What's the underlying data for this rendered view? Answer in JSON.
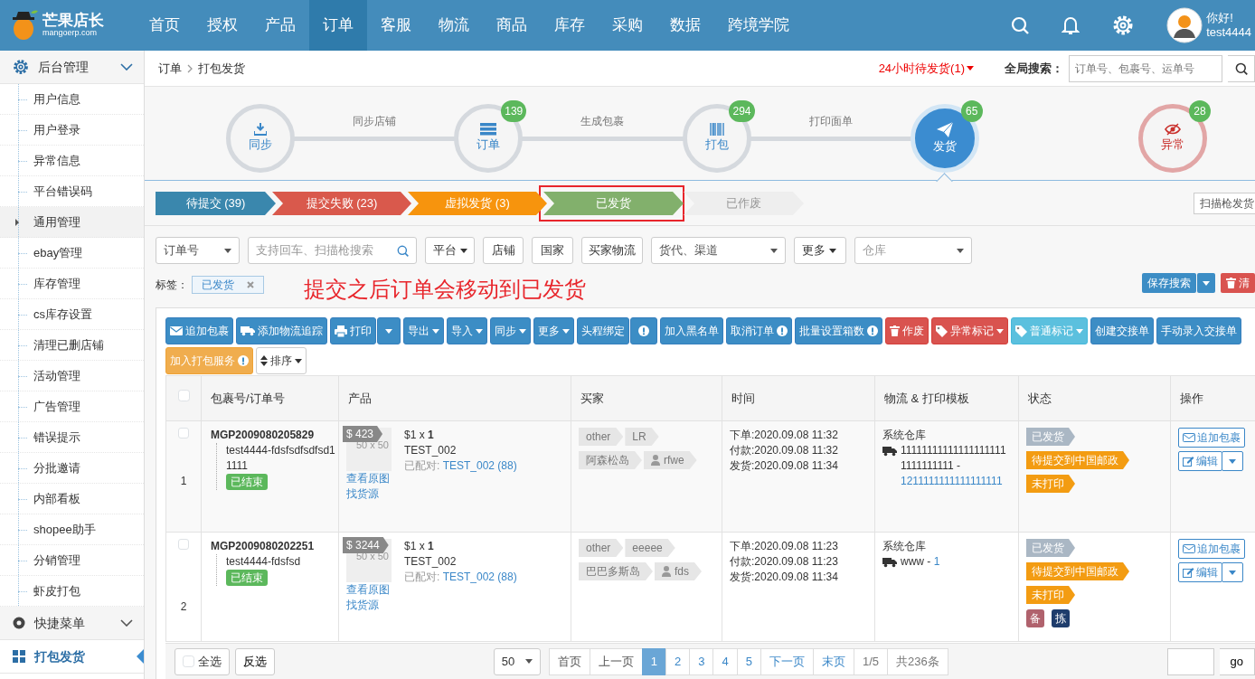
{
  "header": {
    "logo": {
      "name": "芒果店长",
      "domain": "mangoerp.com"
    },
    "nav": [
      {
        "label": "首页",
        "selected": false
      },
      {
        "label": "授权",
        "selected": false
      },
      {
        "label": "产品",
        "selected": false
      },
      {
        "label": "订单",
        "selected": true
      },
      {
        "label": "客服",
        "selected": false
      },
      {
        "label": "物流",
        "selected": false
      },
      {
        "label": "商品",
        "selected": false
      },
      {
        "label": "库存",
        "selected": false
      },
      {
        "label": "采购",
        "selected": false
      },
      {
        "label": "数据",
        "selected": false
      },
      {
        "label": "跨境学院",
        "selected": false
      }
    ],
    "user": {
      "greeting": "你好!",
      "name": "test4444"
    }
  },
  "sidebar": {
    "groups": [
      {
        "label": "后台管理",
        "selected": false,
        "items": [
          {
            "label": "用户信息",
            "selected": false
          },
          {
            "label": "用户登录",
            "selected": false
          },
          {
            "label": "异常信息",
            "selected": false
          },
          {
            "label": "平台错误码",
            "selected": false
          },
          {
            "label": "通用管理",
            "selected": true
          },
          {
            "label": "ebay管理",
            "selected": false
          },
          {
            "label": "库存管理",
            "selected": false
          },
          {
            "label": "cs库存设置",
            "selected": false
          },
          {
            "label": "清理已删店铺",
            "selected": false
          },
          {
            "label": "活动管理",
            "selected": false
          },
          {
            "label": "广告管理",
            "selected": false
          },
          {
            "label": "错误提示",
            "selected": false
          },
          {
            "label": "分批邀请",
            "selected": false
          },
          {
            "label": "内部看板",
            "selected": false
          },
          {
            "label": "shopee助手",
            "selected": false
          },
          {
            "label": "分销管理",
            "selected": false
          },
          {
            "label": "虾皮打包",
            "selected": false
          }
        ]
      },
      {
        "label": "快捷菜单",
        "selected": false
      },
      {
        "label": "打包发货",
        "selected": true
      }
    ]
  },
  "breadcrumb": {
    "items": [
      "订单",
      "打包发货"
    ],
    "alert": "24小时待发货(1)",
    "search_label": "全局搜索：",
    "search_placeholder": "订单号、包裹号、运单号"
  },
  "workflow": [
    {
      "kind": "step",
      "label": "同步",
      "selected": false,
      "alert": false
    },
    {
      "kind": "link",
      "label": "同步店铺"
    },
    {
      "kind": "step",
      "label": "订单",
      "count": "139",
      "selected": false,
      "alert": false
    },
    {
      "kind": "link",
      "label": "生成包裹"
    },
    {
      "kind": "step",
      "label": "打包",
      "count": "294",
      "selected": false,
      "alert": false
    },
    {
      "kind": "link",
      "label": "打印面单"
    },
    {
      "kind": "step",
      "label": "发货",
      "count": "65",
      "selected": true,
      "alert": false
    },
    {
      "kind": "step",
      "label": "异常",
      "count": "28",
      "selected": false,
      "alert": true
    }
  ],
  "status_tabs": [
    {
      "label": "待提交 (39)",
      "color": "#3a87ad",
      "selected": false
    },
    {
      "label": "提交失败 (23)",
      "color": "#d9594c",
      "selected": false
    },
    {
      "label": "虚拟发货 (3)",
      "color": "#f7940d",
      "selected": false
    },
    {
      "label": "已发货",
      "color": "#82b06c",
      "selected": true
    },
    {
      "label": "已作废",
      "color": "#eeeeee",
      "selected": false
    }
  ],
  "scan_button": "扫描枪发货",
  "filters": [
    {
      "kind": "select",
      "label": "订单号"
    },
    {
      "kind": "search",
      "placeholder": "支持回车、扫描枪搜索"
    },
    {
      "kind": "dropdown",
      "label": "平台"
    },
    {
      "kind": "button",
      "label": "店铺"
    },
    {
      "kind": "button",
      "label": "国家"
    },
    {
      "kind": "button",
      "label": "买家物流"
    },
    {
      "kind": "select",
      "label": "货代、渠道"
    },
    {
      "kind": "dropdown",
      "label": "更多"
    },
    {
      "kind": "select",
      "placeholder": "仓库"
    }
  ],
  "tags": {
    "label": "标签：",
    "items": [
      "已发货"
    ]
  },
  "annotation": "提交之后订单会移动到已发货",
  "search_actions": [
    {
      "kind": "split",
      "label": "保存搜索"
    },
    {
      "kind": "danger",
      "label": "清"
    }
  ],
  "toolbar": [
    {
      "label": "追加包裹",
      "kind": "plain"
    },
    {
      "label": "添加物流追踪",
      "kind": "plain"
    },
    {
      "label": "打印",
      "kind": "split"
    },
    {
      "label": "导出",
      "kind": "menu"
    },
    {
      "label": "导入",
      "kind": "menu"
    },
    {
      "label": "同步",
      "kind": "menu"
    },
    {
      "label": "更多",
      "kind": "menu"
    },
    {
      "label": "头程绑定",
      "kind": "info-split"
    },
    {
      "label": "加入黑名单",
      "kind": "plain"
    },
    {
      "label": "取消订单",
      "kind": "info"
    },
    {
      "label": "批量设置箱数",
      "kind": "info"
    },
    {
      "label": "作废",
      "kind": "plain"
    },
    {
      "label": "异常标记",
      "kind": "menu"
    },
    {
      "label": "普通标记",
      "kind": "menu"
    },
    {
      "label": "创建交接单",
      "kind": "plain"
    },
    {
      "label": "手动录入交接单",
      "kind": "plain"
    },
    {
      "label": "加入打包服务",
      "kind": "info"
    },
    {
      "label": "排序",
      "kind": "menu"
    }
  ],
  "table": {
    "select_all": {
      "checked": false
    },
    "columns": [
      "包裹号/订单号",
      "产品",
      "买家",
      "时间",
      "物流 & 打印模板",
      "状态",
      "操作"
    ],
    "rows": [
      {
        "checked": false,
        "index": "1",
        "package_no": "MGP2009080205829",
        "order_no": "test4444-fdsfsdfsdfsd11111",
        "order_status": "已结束",
        "price": "$ 423",
        "thumb": "50 x 50",
        "links": [
          "查看原图",
          "找货源"
        ],
        "quantity": "$1 x **1**",
        "sku": "TEST_002",
        "matched_label": "已配对:",
        "matched": "TEST_002 (88)",
        "buyer_tags": [
          "other",
          "LR"
        ],
        "buyer_region": "阿森松岛",
        "buyer_name": "rfwe",
        "times": [
          "下单:2020.09.08 11:32",
          "付款:2020.09.08 11:32",
          "发货:2020.09.08 11:34"
        ],
        "warehouse": "系统仓库",
        "tracking": "111111111111111111111111111111 -",
        "tracking_link": "1211111111111111111",
        "statuses": [
          {
            "label": "已发货",
            "color": "#aab7c4"
          },
          {
            "label": "待提交到中国邮政",
            "color": "#f39c12"
          },
          {
            "label": "未打印",
            "color": "#f39c12"
          }
        ],
        "actions": [
          "追加包裹",
          "编辑"
        ]
      },
      {
        "checked": false,
        "index": "2",
        "package_no": "MGP2009080202251",
        "order_no": "test4444-fdsfsd",
        "order_status": "已结束",
        "price": "$ 3244",
        "thumb": "50 x 50",
        "links": [
          "查看原图",
          "找货源"
        ],
        "quantity": "$1 x **1**",
        "sku": "TEST_002",
        "matched_label": "已配对:",
        "matched": "TEST_002 (88)",
        "buyer_tags": [
          "other",
          "eeeee"
        ],
        "buyer_region": "巴巴多斯岛",
        "buyer_name": "fds",
        "times": [
          "下单:2020.09.08 11:23",
          "付款:2020.09.08 11:23",
          "发货:2020.09.08 11:34"
        ],
        "warehouse": "系统仓库",
        "tracking": "www -",
        "tracking_link": "1",
        "statuses": [
          {
            "label": "已发货",
            "color": "#aab7c4"
          },
          {
            "label": "待提交到中国邮政",
            "color": "#f39c12"
          },
          {
            "label": "未打印",
            "color": "#f39c12"
          }
        ],
        "flags": [
          {
            "label": "备",
            "color": "#b0626d"
          },
          {
            "label": "拣",
            "color": "#1f3d6c"
          }
        ],
        "actions": [
          "追加包裹",
          "编辑"
        ]
      }
    ]
  },
  "footer": {
    "select_all": {
      "label": "全选",
      "checked": false
    },
    "invert": "反选",
    "page_size": "50",
    "pages": [
      {
        "label": "首页",
        "selected": false
      },
      {
        "label": "上一页",
        "selected": false
      },
      {
        "label": "1",
        "selected": true
      },
      {
        "label": "2",
        "selected": false
      },
      {
        "label": "3",
        "selected": false
      },
      {
        "label": "4",
        "selected": false
      },
      {
        "label": "5",
        "selected": false
      },
      {
        "label": "下一页",
        "selected": false
      },
      {
        "label": "末页",
        "selected": false
      }
    ],
    "page_info": "1/5",
    "total": "共236条",
    "go_button": "go"
  }
}
